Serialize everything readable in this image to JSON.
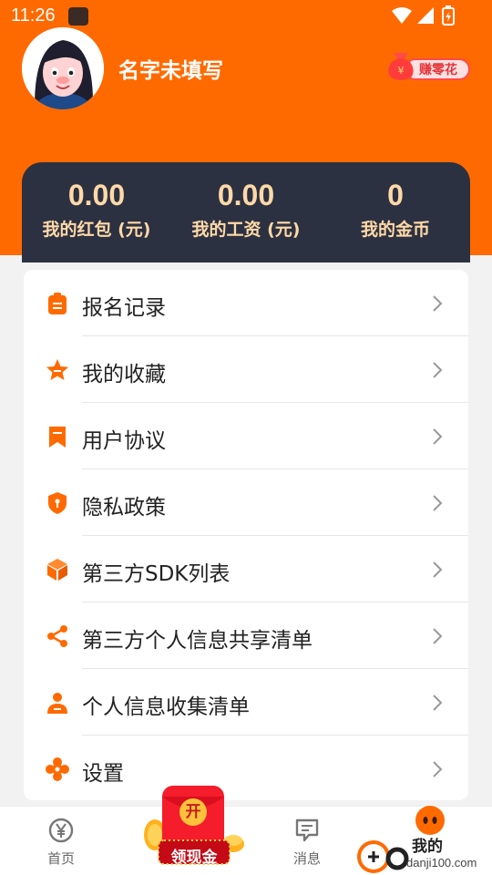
{
  "status_bar": {
    "time": "11:26"
  },
  "profile": {
    "name": "名字未填写",
    "earn_badge": "赚零花"
  },
  "stats": [
    {
      "value": "0.00",
      "label": "我的红包 (元)"
    },
    {
      "value": "0.00",
      "label": "我的工资 (元)"
    },
    {
      "value": "0",
      "label": "我的金币"
    }
  ],
  "menu": [
    {
      "label": "报名记录",
      "icon": "clipboard-icon"
    },
    {
      "label": "我的收藏",
      "icon": "star-icon"
    },
    {
      "label": "用户协议",
      "icon": "bookmark-icon"
    },
    {
      "label": "隐私政策",
      "icon": "shield-icon"
    },
    {
      "label": "第三方SDK列表",
      "icon": "cube-icon"
    },
    {
      "label": "第三方个人信息共享清单",
      "icon": "share-icon"
    },
    {
      "label": "个人信息收集清单",
      "icon": "person-icon"
    },
    {
      "label": "设置",
      "icon": "settings-icon"
    }
  ],
  "tabs": [
    {
      "label": "首页",
      "icon": "yen-circle-icon"
    },
    {
      "label": "领现金",
      "badge": "开",
      "icon": "red-envelope-icon"
    },
    {
      "label": "消息",
      "icon": "message-icon"
    },
    {
      "label": "我的",
      "icon": "face-icon"
    }
  ],
  "watermark": {
    "url": "danji100.com"
  },
  "colors": {
    "primary": "#ff6a00",
    "card_dark": "#2c3141",
    "stat_text": "#ffd9a8"
  }
}
